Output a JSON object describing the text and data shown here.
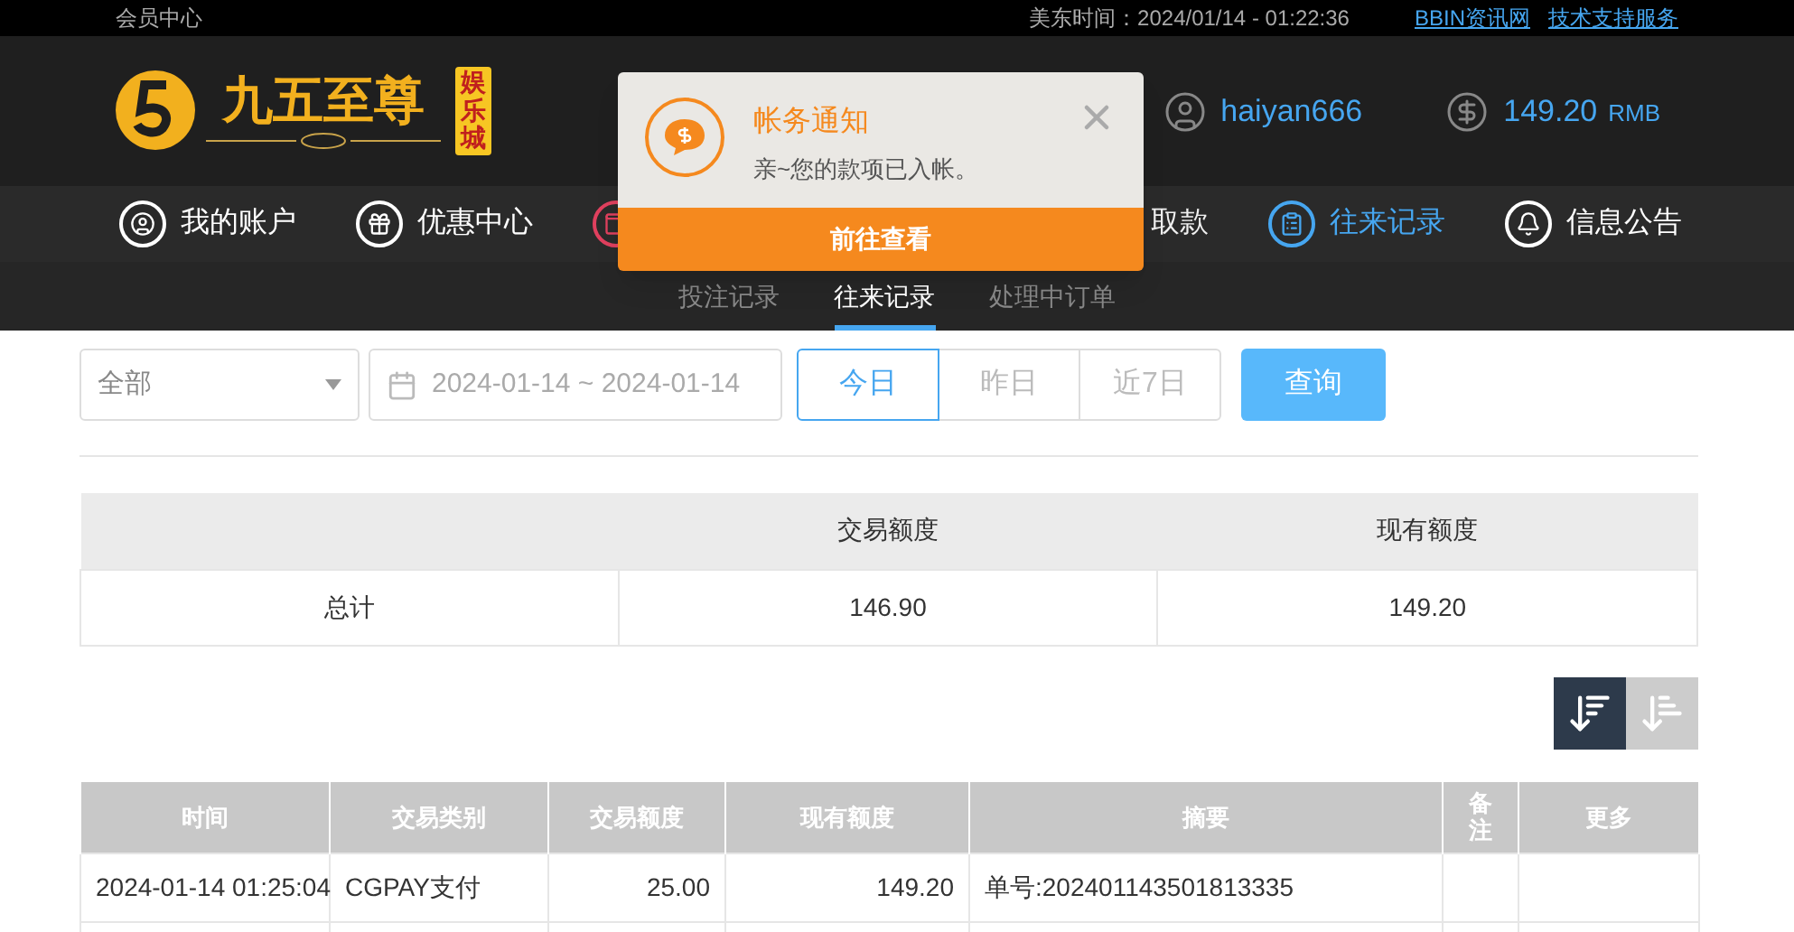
{
  "top_bar": {
    "title": "会员中心",
    "time": "美东时间：2024/01/14 - 01:22:36",
    "links": [
      "BBIN资讯网",
      "技术支持服务"
    ]
  },
  "header": {
    "logo_text": "九五至尊",
    "logo_badge": "娱乐城",
    "username": "haiyan666",
    "balance": "149.20",
    "currency": "RMB"
  },
  "nav": [
    {
      "label": "我的账户",
      "kind": "account",
      "selected": false
    },
    {
      "label": "优惠中心",
      "kind": "gift",
      "selected": false
    },
    {
      "kind": "wallet",
      "selected": false
    },
    {
      "label": "取款",
      "kind": "withdraw",
      "selected": false
    },
    {
      "label": "往来记录",
      "kind": "records",
      "selected": true
    },
    {
      "label": "信息公告",
      "kind": "notice",
      "selected": false
    }
  ],
  "sub_tabs": [
    {
      "label": "投注记录",
      "selected": false
    },
    {
      "label": "往来记录",
      "selected": true
    },
    {
      "label": "处理中订单",
      "selected": false
    }
  ],
  "notification": {
    "title": "帐务通知",
    "message": "亲~您的款项已入帐。",
    "action": "前往查看"
  },
  "filters": {
    "type_select": "全部",
    "date_range": "2024-01-14 ~ 2024-01-14",
    "quick_ranges": [
      {
        "label": "今日",
        "selected": true
      },
      {
        "label": "昨日",
        "selected": false
      },
      {
        "label": "近7日",
        "selected": false
      }
    ],
    "query_button": "查询"
  },
  "summary": {
    "columns": [
      "",
      "交易额度",
      "现有额度"
    ],
    "rows": [
      [
        "总计",
        "146.90",
        "149.20"
      ]
    ]
  },
  "sort_buttons": [
    {
      "kind": "desc",
      "selected": true
    },
    {
      "kind": "asc",
      "selected": false
    }
  ],
  "transactions": {
    "columns": [
      "时间",
      "交易类别",
      "交易额度",
      "现有额度",
      "摘要",
      "备注",
      "更多"
    ],
    "rows": [
      [
        "2024-01-14 01:25:04",
        "CGPAY支付",
        "25.00",
        "149.20",
        "单号:202401143501813335",
        "",
        ""
      ]
    ]
  }
}
